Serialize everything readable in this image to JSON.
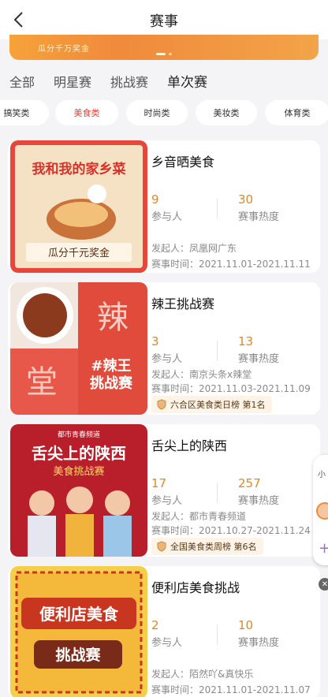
{
  "header": {
    "title": "赛事"
  },
  "banner": {
    "text": "瓜分千万奖金"
  },
  "tabs": [
    "全部",
    "明星赛",
    "挑战赛",
    "单次赛"
  ],
  "chips": [
    "搞笑类",
    "美食类",
    "时尚类",
    "美妆类",
    "体育类"
  ],
  "labels": {
    "participants": "参与人",
    "heat": "赛事热度"
  },
  "cards": [
    {
      "title": "乡音晒美食",
      "participants": "9",
      "heat": "30",
      "organizer": "发起人：凤凰网广东",
      "time": "赛事时间：2021.11.01-2021.11.11",
      "rank": "",
      "thumb_text": [
        "我和我的家乡菜",
        "瓜分千元奖金"
      ]
    },
    {
      "title": "辣王挑战赛",
      "participants": "3",
      "heat": "13",
      "organizer": "发起人：南京头条x辣堂",
      "time": "赛事时间：2021.11.03-2021.11.09",
      "rank": "六合区美食类日榜  第1名",
      "thumb_text": [
        "辣",
        "堂",
        "#辣王",
        "挑战赛"
      ]
    },
    {
      "title": "舌尖上的陕西",
      "participants": "17",
      "heat": "257",
      "organizer": "发起人：都市青春频道",
      "time": "赛事时间：2021.10.27-2021.11.24",
      "rank": "全国美食类周榜  第6名",
      "thumb_text": [
        "都市青春频道",
        "舌尖上的陕西",
        "美食挑战赛"
      ]
    },
    {
      "title": "便利店美食挑战",
      "participants": "2",
      "heat": "10",
      "organizer": "发起人：陌然吖&真快乐",
      "time": "赛事时间：2021.11.01-2021.11.07",
      "rank": "",
      "thumb_text": [
        "便利店美食",
        "挑战赛"
      ]
    }
  ],
  "float": {
    "label": "小",
    "plus": "+"
  },
  "colors": {
    "accent": "#e2871c",
    "active_chip": "#e0413a",
    "brand_red": "#c8332b"
  }
}
